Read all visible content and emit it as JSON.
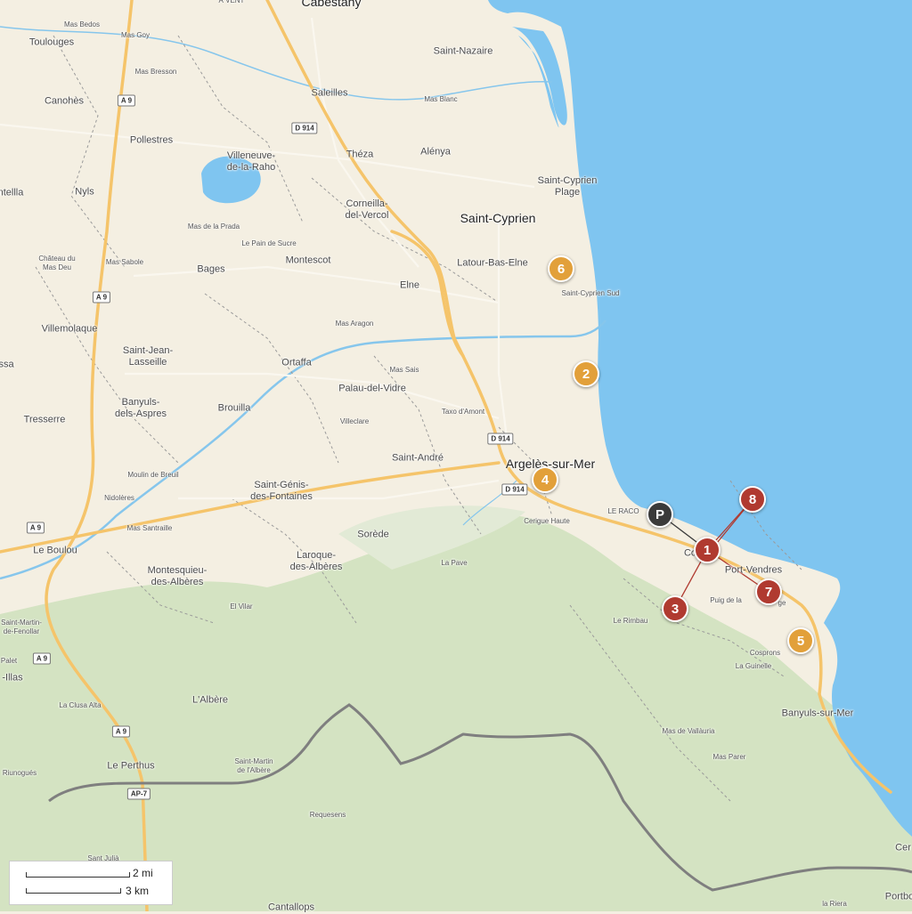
{
  "colors": {
    "land": "#f4efe2",
    "sea": "#7fc5f0",
    "lake": "#7fc5f0",
    "forest": "#d4e3c2",
    "road_major": "#f5c46a",
    "border": "#808080",
    "marker_red": "#b03a30",
    "marker_orange": "#e2a03a",
    "marker_dark": "#3a3a3a"
  },
  "places": [
    {
      "name": "Cabestany",
      "cls": "big"
    },
    {
      "name": "À VENT",
      "cls": "small"
    },
    {
      "name": "Mas Bedos",
      "cls": "small"
    },
    {
      "name": "Toulouges",
      "cls": ""
    },
    {
      "name": "Mas Goy",
      "cls": "small"
    },
    {
      "name": "Saint-Nazaire",
      "cls": ""
    },
    {
      "name": "Mas Bresson",
      "cls": "small"
    },
    {
      "name": "Saleilles",
      "cls": ""
    },
    {
      "name": "Mas Blanc",
      "cls": "small"
    },
    {
      "name": "Canohès",
      "cls": ""
    },
    {
      "name": "Pollestres",
      "cls": ""
    },
    {
      "name": "Théza",
      "cls": ""
    },
    {
      "name": "Alénya",
      "cls": ""
    },
    {
      "name": "Villeneuve-\nde-la-Raho",
      "cls": ""
    },
    {
      "name": "Saint-Cyprien\nPlage",
      "cls": ""
    },
    {
      "name": "ntellla",
      "cls": ""
    },
    {
      "name": "Nyls",
      "cls": ""
    },
    {
      "name": "Corneilla-\ndel-Vercol",
      "cls": ""
    },
    {
      "name": "Saint-Cyprien",
      "cls": "big"
    },
    {
      "name": "Mas de la Prada",
      "cls": "small"
    },
    {
      "name": "Le Pain de Sucre",
      "cls": "small"
    },
    {
      "name": "Latour-Bas-Elne",
      "cls": ""
    },
    {
      "name": "Château du\nMas Deu",
      "cls": "small"
    },
    {
      "name": "Mas Sabole",
      "cls": "small"
    },
    {
      "name": "Bages",
      "cls": ""
    },
    {
      "name": "Montescot",
      "cls": ""
    },
    {
      "name": "Saint-Cyprien Sud",
      "cls": "small"
    },
    {
      "name": "Elne",
      "cls": ""
    },
    {
      "name": "Mas Aragon",
      "cls": "small"
    },
    {
      "name": "Villemolaque",
      "cls": ""
    },
    {
      "name": "Saint-Jean-\nLasseille",
      "cls": ""
    },
    {
      "name": "Ortaffa",
      "cls": ""
    },
    {
      "name": "Mas Sais",
      "cls": "small"
    },
    {
      "name": "ssa",
      "cls": ""
    },
    {
      "name": "Palau-del-Vidre",
      "cls": ""
    },
    {
      "name": "Banyuls-\ndels-Aspres",
      "cls": ""
    },
    {
      "name": "Brouilla",
      "cls": ""
    },
    {
      "name": "Taxo d'Amont",
      "cls": "small"
    },
    {
      "name": "Tresserre",
      "cls": ""
    },
    {
      "name": "Villeclare",
      "cls": "small"
    },
    {
      "name": "Saint-André",
      "cls": ""
    },
    {
      "name": "Argelès-sur-Mer",
      "cls": "big"
    },
    {
      "name": "Moulin de Breuil",
      "cls": "small"
    },
    {
      "name": "Saint-Génis-\ndes-Fontaines",
      "cls": ""
    },
    {
      "name": "Nidolères",
      "cls": "small"
    },
    {
      "name": "LE RACO",
      "cls": "small"
    },
    {
      "name": "Cerigue Haute",
      "cls": "small"
    },
    {
      "name": "Mas Santraille",
      "cls": "small"
    },
    {
      "name": "Sorède",
      "cls": ""
    },
    {
      "name": "Le Boulou",
      "cls": ""
    },
    {
      "name": "Laroque-\ndes-Albères",
      "cls": ""
    },
    {
      "name": "Co",
      "cls": ""
    },
    {
      "name": "Port-Vendres",
      "cls": ""
    },
    {
      "name": "La Pave",
      "cls": "small"
    },
    {
      "name": "Montesquieu-\ndes-Albères",
      "cls": ""
    },
    {
      "name": "Puig de la",
      "cls": "small"
    },
    {
      "name": "ge",
      "cls": "small"
    },
    {
      "name": "El Vilar",
      "cls": "small"
    },
    {
      "name": "Le Rimbau",
      "cls": "small"
    },
    {
      "name": "Saint-Martin-\nde-Fenollar",
      "cls": "small"
    },
    {
      "name": "Palet",
      "cls": "small"
    },
    {
      "name": "Cosprons",
      "cls": "small"
    },
    {
      "name": "-Illas",
      "cls": ""
    },
    {
      "name": "La Guinelle",
      "cls": "small"
    },
    {
      "name": "La Clusa Alta",
      "cls": "small"
    },
    {
      "name": "L'Albère",
      "cls": ""
    },
    {
      "name": "Banyuls-sur-Mer",
      "cls": ""
    },
    {
      "name": "Mas de Vallàuria",
      "cls": "small"
    },
    {
      "name": "Mas Parer",
      "cls": "small"
    },
    {
      "name": "Saint-Martin\nde l'Albère",
      "cls": "small"
    },
    {
      "name": "Le Perthus",
      "cls": ""
    },
    {
      "name": "Riunogués",
      "cls": "small"
    },
    {
      "name": "Requesens",
      "cls": "small"
    },
    {
      "name": "Sant Julià",
      "cls": "small"
    },
    {
      "name": "Cantallops",
      "cls": ""
    },
    {
      "name": "la Riera",
      "cls": "small"
    },
    {
      "name": "Cer",
      "cls": ""
    },
    {
      "name": "Portbo",
      "cls": ""
    }
  ],
  "road_shields": [
    "A 9",
    "D 914",
    "A 9",
    "D 914",
    "D 914",
    "A 9",
    "A 9",
    "A 9",
    "AP-7"
  ],
  "markers": [
    {
      "label": "6",
      "color": "orange"
    },
    {
      "label": "2",
      "color": "orange"
    },
    {
      "label": "4",
      "color": "orange"
    },
    {
      "label": "5",
      "color": "orange"
    },
    {
      "label": "P",
      "color": "dark"
    },
    {
      "label": "1",
      "color": "red"
    },
    {
      "label": "8",
      "color": "red"
    },
    {
      "label": "7",
      "color": "red"
    },
    {
      "label": "3",
      "color": "red"
    }
  ],
  "scale": {
    "miles": "2 mi",
    "km": "3 km"
  }
}
